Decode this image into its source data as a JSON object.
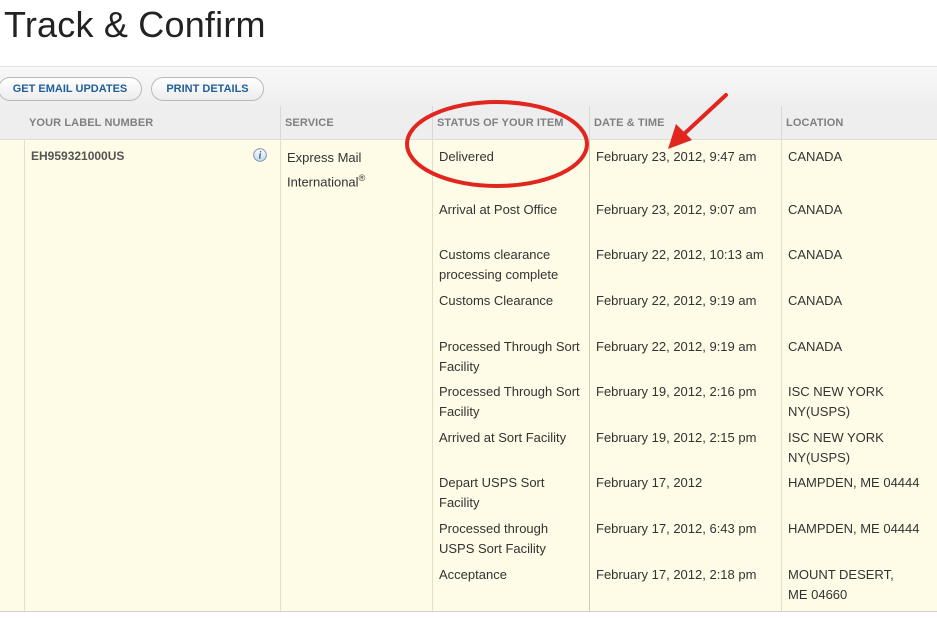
{
  "page_title": "Track & Confirm",
  "toolbar": {
    "email_label": "GET EMAIL UPDATES",
    "print_label": "PRINT DETAILS"
  },
  "columns": {
    "label_number": "YOUR LABEL NUMBER",
    "service": "SERVICE",
    "status": "STATUS OF YOUR ITEM",
    "datetime": "DATE & TIME",
    "location": "LOCATION"
  },
  "item": {
    "label_number": "EH959321000US",
    "service_line1": "Express Mail",
    "service_line2": "International",
    "service_mark": "®",
    "info_icon": "info-icon"
  },
  "rows": [
    {
      "status": "Delivered",
      "datetime": "February 23, 2012, 9:47 am",
      "location": "CANADA"
    },
    {
      "status": "Arrival at Post Office",
      "datetime": "February 23, 2012, 9:07 am",
      "location": "CANADA"
    },
    {
      "status": "Customs clearance processing complete",
      "datetime": "February 22, 2012, 10:13 am",
      "location": "CANADA"
    },
    {
      "status": "Customs Clearance",
      "datetime": "February 22, 2012, 9:19 am",
      "location": "CANADA"
    },
    {
      "status": "Processed Through Sort Facility",
      "datetime": "February 22, 2012, 9:19 am",
      "location": "CANADA"
    },
    {
      "status": "Processed Through Sort Facility",
      "datetime": "February 19, 2012, 2:16 pm",
      "location": "ISC NEW YORK NY(USPS)"
    },
    {
      "status": "Arrived at Sort Facility",
      "datetime": "February 19, 2012, 2:15 pm",
      "location": "ISC NEW YORK NY(USPS)"
    },
    {
      "status": "Depart USPS Sort Facility",
      "datetime": "February 17, 2012",
      "location": "HAMPDEN, ME 04444"
    },
    {
      "status": "Processed through USPS Sort Facility",
      "datetime": "February 17, 2012, 6:43 pm",
      "location": "HAMPDEN, ME 04444"
    },
    {
      "status": "Acceptance",
      "datetime": "February 17, 2012, 2:18 pm",
      "location": "MOUNT DESERT, ME 04660"
    }
  ],
  "annotations": {
    "highlight_color": "#e0261f",
    "circle_target": "Delivered",
    "arrow_target": "February 23, 2012, 9:47 am"
  },
  "colors": {
    "body_background": "#fefbe6",
    "header_background": "#eeeeee",
    "button_text": "#1f5f9a"
  }
}
